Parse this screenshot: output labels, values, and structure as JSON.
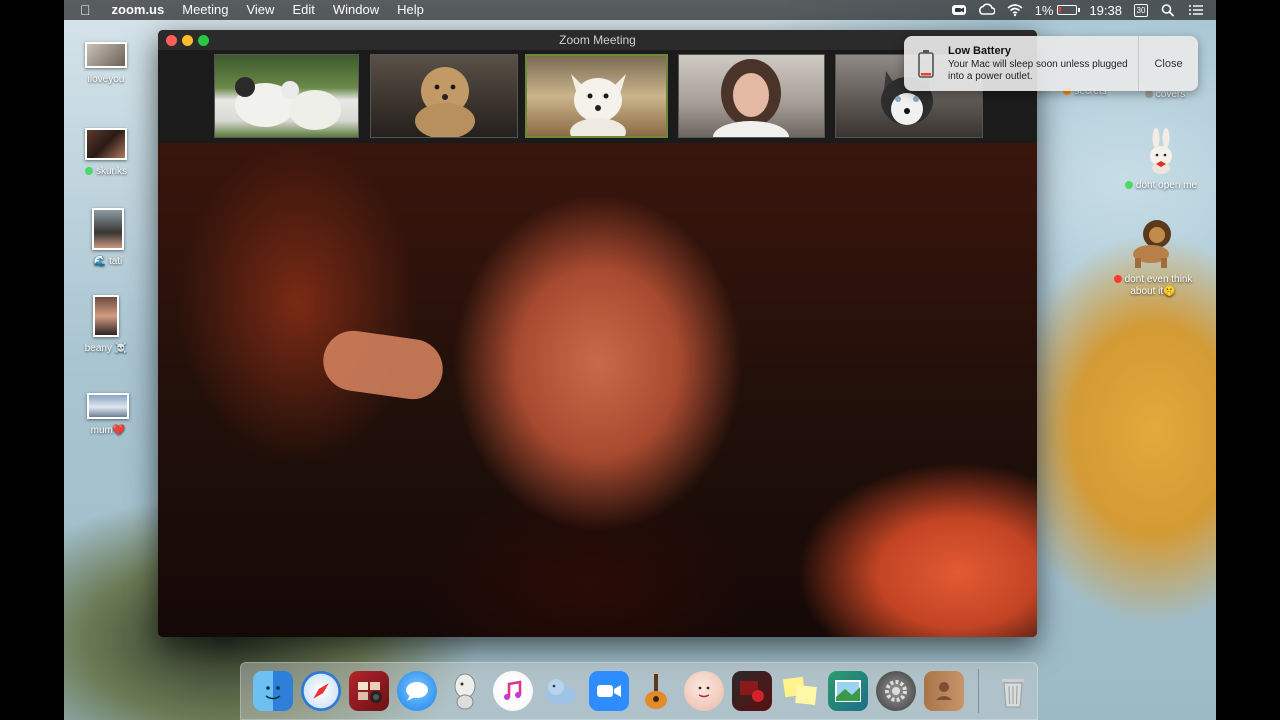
{
  "menubar": {
    "app_name": "zoom.us",
    "menus": [
      "Meeting",
      "View",
      "Edit",
      "Window",
      "Help"
    ],
    "battery_percent": "1%",
    "time": "19:38",
    "calendar_day": "30"
  },
  "desktop_left": [
    {
      "label": "iloveyou"
    },
    {
      "label": "skunks",
      "tag_color": "#4cd964"
    },
    {
      "label": "tati",
      "emoji": "🌊"
    },
    {
      "label": "beany",
      "emoji": "☠️"
    },
    {
      "label": "mum",
      "emoji": "❤️"
    }
  ],
  "desktop_right": [
    {
      "label": "secrets",
      "tag_color": "#ff9500"
    },
    {
      "label": "covers",
      "tag_color": "#a0a0a0"
    },
    {
      "label": "dont open me",
      "tag_color": "#4cd964"
    },
    {
      "label": "dont even think about it",
      "tag_color": "#ff3b30",
      "emoji": "🤫"
    }
  ],
  "zoom": {
    "window_title": "Zoom Meeting",
    "participants": [
      "participant-dogs",
      "participant-poodle",
      "participant-terrier",
      "participant-woman",
      "participant-husky"
    ]
  },
  "notification": {
    "title": "Low Battery",
    "body": "Your Mac will sleep soon unless plugged into a power outlet.",
    "close_label": "Close"
  },
  "dock": {
    "apps": [
      "finder",
      "safari",
      "photo-booth",
      "messages",
      "inkscape",
      "itunes",
      "sequel",
      "zoom",
      "garageband",
      "face-app",
      "photo-slideshow",
      "stickies",
      "preview",
      "system-preferences",
      "contacts",
      "trash"
    ]
  },
  "colors": {
    "menubar": "#282828",
    "zoom_titlebar": "#2b2b2b",
    "low_battery_red": "#ff3b30"
  }
}
